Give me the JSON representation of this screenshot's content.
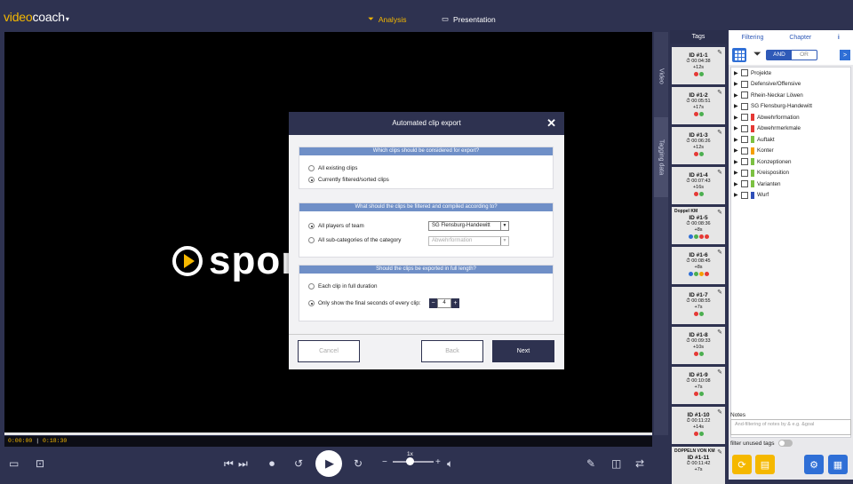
{
  "app": {
    "logo_prefix": "video",
    "logo_suffix": "coach",
    "nav": {
      "analysis": "Analysis",
      "presentation": "Presentation"
    }
  },
  "video": {
    "watermark": "spor",
    "side_tabs": {
      "video": "Video",
      "tagging": "Tagging data"
    },
    "current_time": "0:00:00",
    "total_time": "0:18:30",
    "speed_label": "1x"
  },
  "tags": {
    "header": "Tags",
    "items": [
      {
        "id": "ID #1-1",
        "time": "00:04:38",
        "dur": "+12s",
        "title": "",
        "colors": [
          "#e53935",
          "#4caf50"
        ]
      },
      {
        "id": "ID #1-2",
        "time": "00:05:51",
        "dur": "+17s",
        "title": "",
        "colors": [
          "#e53935",
          "#4caf50"
        ]
      },
      {
        "id": "ID #1-3",
        "time": "00:06:26",
        "dur": "+12s",
        "title": "",
        "colors": [
          "#e53935",
          "#4caf50"
        ]
      },
      {
        "id": "ID #1-4",
        "time": "00:07:43",
        "dur": "+16s",
        "title": "",
        "colors": [
          "#e53935",
          "#4caf50"
        ]
      },
      {
        "id": "ID #1-5",
        "time": "00:08:36",
        "dur": "+8s",
        "title": "Doppel KM",
        "colors": [
          "#2f6fd6",
          "#4caf50",
          "#e53935",
          "#e53935"
        ]
      },
      {
        "id": "ID #1-6",
        "time": "00:08:45",
        "dur": "+8s",
        "title": "",
        "colors": [
          "#2f6fd6",
          "#4caf50",
          "#f59f00",
          "#e53935"
        ]
      },
      {
        "id": "ID #1-7",
        "time": "00:08:55",
        "dur": "+7s",
        "title": "",
        "colors": [
          "#e53935",
          "#4caf50"
        ]
      },
      {
        "id": "ID #1-8",
        "time": "00:09:33",
        "dur": "+10s",
        "title": "",
        "colors": [
          "#e53935",
          "#4caf50"
        ]
      },
      {
        "id": "ID #1-9",
        "time": "00:10:08",
        "dur": "+7s",
        "title": "",
        "colors": [
          "#e53935",
          "#4caf50"
        ]
      },
      {
        "id": "ID #1-10",
        "time": "00:11:22",
        "dur": "+14s",
        "title": "",
        "colors": [
          "#e53935",
          "#4caf50"
        ]
      },
      {
        "id": "ID #1-11",
        "time": "00:11:42",
        "dur": "+7s",
        "title": "DOPPELN VON KM",
        "colors": []
      }
    ]
  },
  "filter": {
    "tabs": {
      "filtering": "Filtering",
      "chapter": "Chapter",
      "info": "i"
    },
    "and_label": "AND",
    "or_label": "OR",
    "next_label": ">",
    "categories": [
      {
        "label": "Projekte",
        "color": ""
      },
      {
        "label": "Defensive/Offensive",
        "color": ""
      },
      {
        "label": "Rhein-Neckar Löwen",
        "color": ""
      },
      {
        "label": "SG Flensburg-Handewitt",
        "color": ""
      },
      {
        "label": "Abwehrformation",
        "color": "#e53935"
      },
      {
        "label": "Abwehrmerkmale",
        "color": "#e53935"
      },
      {
        "label": "Auftakt",
        "color": "#7cc142"
      },
      {
        "label": "Konter",
        "color": "#f59f00"
      },
      {
        "label": "Konzeptionen",
        "color": "#7cc142"
      },
      {
        "label": "Kreisposition",
        "color": "#7cc142"
      },
      {
        "label": "Varianten",
        "color": "#7cc142"
      },
      {
        "label": "Wurf",
        "color": "#2f4fb8"
      }
    ],
    "notes_label": "Notes",
    "notes_placeholder": "And-filtering of notes by & e.g. &goal",
    "unused_label": "filter unused tags"
  },
  "modal": {
    "title": "Automated clip export",
    "close": "✕",
    "section1": {
      "header": "Which clips should be considered for export?",
      "opt1": "All existing clips",
      "opt2": "Currently filtered/sorted clips"
    },
    "section2": {
      "header": "What should the clips be filtered and compiled according to?",
      "opt1": "All players of team",
      "opt2": "All sub-categories of the category",
      "team_value": "SG Flensburg-Handewitt",
      "category_value": "Abwehrformation"
    },
    "section3": {
      "header": "Should the clips be exported in full length?",
      "opt1": "Each clip in full duration",
      "opt2": "Only show the final seconds of every clip:",
      "seconds": "4",
      "minus": "−",
      "plus": "+"
    },
    "buttons": {
      "cancel": "Cancel",
      "back": "Back",
      "next": "Next"
    }
  }
}
